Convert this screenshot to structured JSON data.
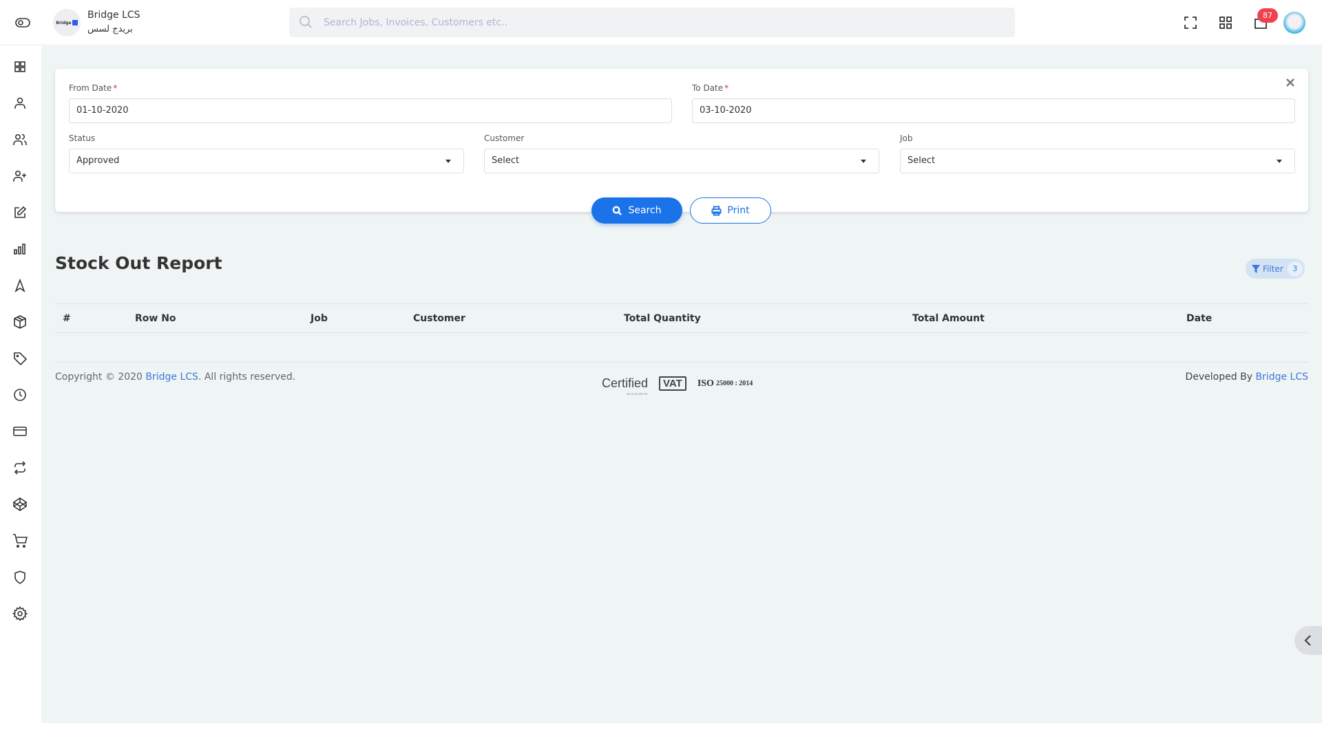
{
  "header": {
    "brand_name": "Bridge LCS",
    "brand_arabic": "بريدج لسس",
    "logo_text": "Bridge",
    "search_placeholder": "Search Jobs, Invoices, Customers etc..",
    "notification_count": "87",
    "icons": [
      "sidebar-toggle-icon",
      "fullscreen-icon",
      "apps-grid-icon",
      "notifications-icon",
      "user-avatar"
    ]
  },
  "sidebar": {
    "items": [
      {
        "icon": "dashboard-grid-icon"
      },
      {
        "icon": "user-icon"
      },
      {
        "icon": "users-icon"
      },
      {
        "icon": "user-plus-icon"
      },
      {
        "icon": "edit-icon"
      },
      {
        "icon": "bar-chart-icon"
      },
      {
        "icon": "navigation-icon"
      },
      {
        "icon": "package-icon"
      },
      {
        "icon": "tag-icon"
      },
      {
        "icon": "clock-icon"
      },
      {
        "icon": "credit-card-icon"
      },
      {
        "icon": "repeat-icon"
      },
      {
        "icon": "codepen-icon"
      },
      {
        "icon": "shopping-cart-icon"
      },
      {
        "icon": "shield-icon"
      },
      {
        "icon": "settings-icon"
      }
    ]
  },
  "form": {
    "from_date": {
      "label": "From Date",
      "required": "*",
      "value": "01-10-2020"
    },
    "to_date": {
      "label": "To Date",
      "required": "*",
      "value": "03-10-2020"
    },
    "status": {
      "label": "Status",
      "value": "Approved"
    },
    "customer": {
      "label": "Customer",
      "value": "Select"
    },
    "job": {
      "label": "Job",
      "value": "Select"
    },
    "search_label": "Search",
    "print_label": "Print"
  },
  "report": {
    "title": "Stock Out Report",
    "filter_label": "Filter",
    "filter_count": "3",
    "columns": [
      "#",
      "Row No",
      "Job",
      "Customer",
      "Total Quantity",
      "Total Amount",
      "Date"
    ],
    "rows": []
  },
  "footer": {
    "copyright_prefix": "Copyright © 2020 ",
    "copyright_link": "Bridge LCS",
    "copyright_suffix": ". All rights reserved.",
    "developed_prefix": "Developed By ",
    "developed_link": "Bridge LCS",
    "cert_certified": "Certified",
    "cert_accounts": "ACCOUNTS",
    "cert_vat": "VAT",
    "cert_iso": "ISO",
    "cert_iso_num": "25000 : 2014"
  },
  "colors": {
    "primary": "#1a73e8",
    "badge": "#f1414f",
    "link": "#3c78d8",
    "background": "#eff4f4"
  }
}
